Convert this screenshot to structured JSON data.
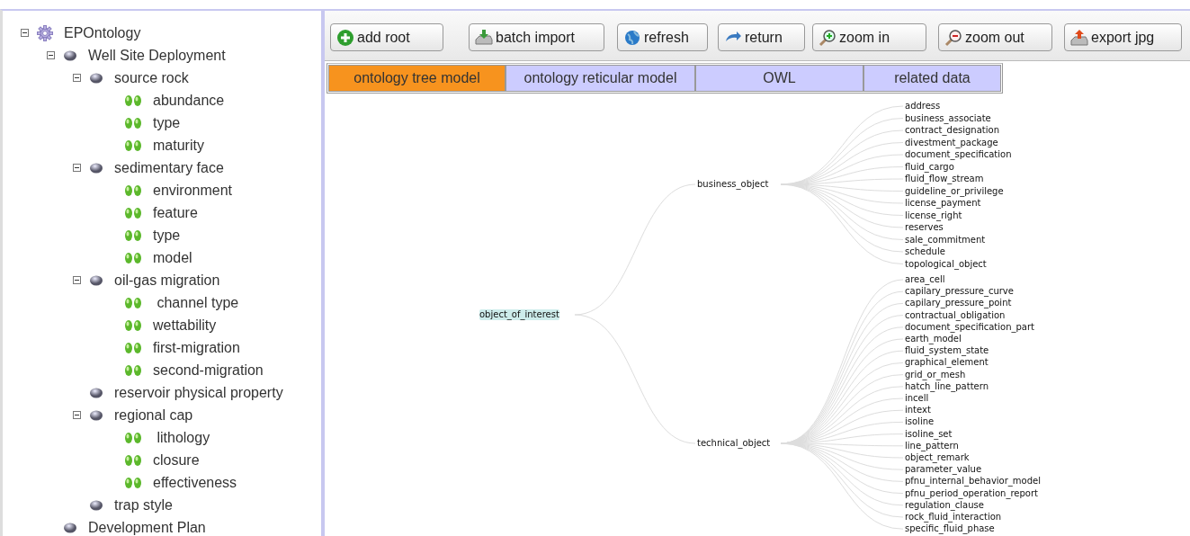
{
  "tree": {
    "label": "EPOntology",
    "kind": "root",
    "expanded": true,
    "children": [
      {
        "label": "Well Site Deployment",
        "kind": "branch",
        "expanded": true,
        "children": [
          {
            "label": "source rock",
            "kind": "branch",
            "expanded": true,
            "children": [
              {
                "label": "abundance",
                "kind": "leaf"
              },
              {
                "label": "type",
                "kind": "leaf"
              },
              {
                "label": "maturity",
                "kind": "leaf"
              }
            ]
          },
          {
            "label": "sedimentary face",
            "kind": "branch",
            "expanded": true,
            "children": [
              {
                "label": "environment",
                "kind": "leaf"
              },
              {
                "label": "feature",
                "kind": "leaf"
              },
              {
                "label": "type",
                "kind": "leaf"
              },
              {
                "label": "model",
                "kind": "leaf"
              }
            ]
          },
          {
            "label": "oil-gas migration",
            "kind": "branch",
            "expanded": true,
            "children": [
              {
                "label": " channel type",
                "kind": "leaf"
              },
              {
                "label": "wettability",
                "kind": "leaf"
              },
              {
                "label": "first-migration",
                "kind": "leaf"
              },
              {
                "label": "second-migration",
                "kind": "leaf"
              }
            ]
          },
          {
            "label": "reservoir physical property",
            "kind": "branch"
          },
          {
            "label": "regional cap",
            "kind": "branch",
            "expanded": true,
            "children": [
              {
                "label": " lithology",
                "kind": "leaf"
              },
              {
                "label": "closure",
                "kind": "leaf"
              },
              {
                "label": "effectiveness",
                "kind": "leaf"
              }
            ]
          },
          {
            "label": "trap style",
            "kind": "branch"
          }
        ]
      },
      {
        "label": "Development Plan",
        "kind": "branch"
      }
    ]
  },
  "toolbar": [
    {
      "label": "add root",
      "kind": "add"
    },
    {
      "label": "batch import",
      "kind": "import"
    },
    {
      "label": "refresh",
      "kind": "refresh"
    },
    {
      "label": "return",
      "kind": "return"
    },
    {
      "label": "zoom in",
      "kind": "zoom-in"
    },
    {
      "label": "zoom out",
      "kind": "zoom-out"
    },
    {
      "label": "export jpg",
      "kind": "export"
    }
  ],
  "tabs": [
    {
      "label": "ontology tree model",
      "selected": true
    },
    {
      "label": "ontology reticular model",
      "selected": false
    },
    {
      "label": "OWL",
      "selected": false
    },
    {
      "label": "related data",
      "selected": false
    }
  ],
  "graph": {
    "label": "object_of_interest",
    "selected": true,
    "children": [
      {
        "label": "business_object",
        "children": [
          "address",
          "business_associate",
          "contract_designation",
          "divestment_package",
          "document_specification",
          "fluid_cargo",
          "fluid_flow_stream",
          "guideline_or_privilege",
          "license_payment",
          "license_right",
          "reserves",
          "sale_commitment",
          "schedule",
          "topological_object"
        ]
      },
      {
        "label": "technical_object",
        "children": [
          "area_cell",
          "capilary_pressure_curve",
          "capilary_pressure_point",
          "contractual_obligation",
          "document_specification_part",
          "earth_model",
          "fluid_system_state",
          "graphical_element",
          "grid_or_mesh",
          "hatch_line_pattern",
          "incell",
          "intext",
          "isoline",
          "isoline_set",
          "line_pattern",
          "object_remark",
          "parameter_value",
          "pfnu_internal_behavior_model",
          "pfnu_period_operation_report",
          "regulation_clause",
          "rock_fluid_interaction",
          "specific_fluid_phase"
        ]
      }
    ]
  }
}
